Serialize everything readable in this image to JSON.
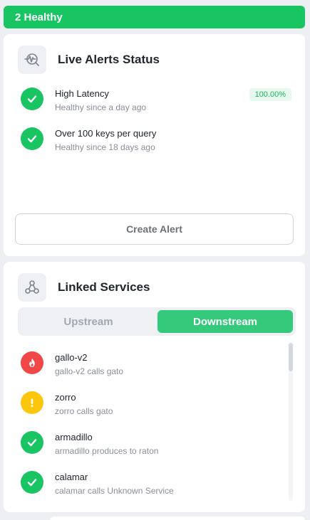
{
  "banner": {
    "text": "2 Healthy",
    "color": "#19c463"
  },
  "alerts_card": {
    "title": "Live Alerts Status",
    "icon": "alert-pulse-search-icon",
    "alerts": [
      {
        "name": "High Latency",
        "status": "Healthy since a day ago",
        "badge": "100.00%",
        "state": "healthy"
      },
      {
        "name": "Over 100 keys per query",
        "status": "Healthy since 18 days ago",
        "state": "healthy"
      }
    ],
    "create_button": "Create Alert"
  },
  "linked_card": {
    "title": "Linked Services",
    "icon": "linked-services-icon",
    "tabs": [
      {
        "label": "Upstream",
        "active": false
      },
      {
        "label": "Downstream",
        "active": true
      }
    ],
    "services": [
      {
        "name": "gallo-v2",
        "relation": "gallo-v2 calls gato",
        "state": "critical",
        "icon": "flame-icon",
        "color": "#f24747"
      },
      {
        "name": "zorro",
        "relation": "zorro calls gato",
        "state": "warning",
        "icon": "exclamation-icon",
        "color": "#fbc60b"
      },
      {
        "name": "armadillo",
        "relation": "armadillo produces to raton",
        "state": "healthy",
        "icon": "check-icon",
        "color": "#19c463"
      },
      {
        "name": "calamar",
        "relation": "calamar calls Unknown Service",
        "state": "healthy",
        "icon": "check-icon",
        "color": "#19c463"
      }
    ]
  }
}
